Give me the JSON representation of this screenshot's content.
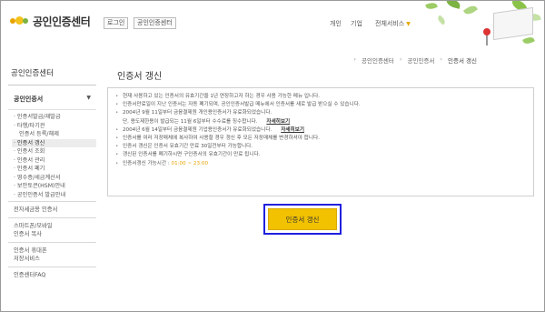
{
  "header": {
    "logo_text": "공인인증센터",
    "login_button": "로그인",
    "cert_center_button": "공인인증센터",
    "nav": {
      "personal": "개인",
      "corporate": "기업",
      "all_services": "전체서비스"
    }
  },
  "breadcrumb": [
    "공인인증센터",
    "공인인증서",
    "인증서 갱신"
  ],
  "sidebar": {
    "title": "공인인증센터",
    "section_header": "공인인증서",
    "sub_items": [
      "· 인증서발급/재발급",
      "· 타행/타기관",
      "  인증서 등록/해제",
      "· 인증서 갱신",
      "· 인증서 조회",
      "· 인증서 관리",
      "· 인증서 폐기",
      "· 영수증/세금계산서",
      "· 보안토큰(HSM)안내",
      "· 공인인증서 발급안내"
    ],
    "active_index": 3,
    "groups": [
      [
        "전자세금용 인증서"
      ],
      [
        "스마트폰/모바일",
        "인증서 복사"
      ],
      [
        "인증서 휴대폰",
        "저장서비스"
      ],
      [
        "인증센터FAQ"
      ]
    ]
  },
  "main": {
    "title": "인증서 갱신",
    "notices": [
      {
        "text": "현재 사용하고 있는 인증서의 유효기간을 1년 연장하고자 하는 경우 사용 가능한 메뉴 입니다."
      },
      {
        "text": "인증서만료일이 지난 인증서는 자동 폐기되며, 공인인증서발급 메뉴에서 인증서를 새로 발급 받으실 수 있습니다."
      },
      {
        "text": "2004년 9월 11일부터 금융결제원 개인용인증서가 유료화되었습니다.",
        "text2": "단, 용도제한용이 발급되는 11월 6일부터 수수료를 징수합니다.",
        "link": "자세히보기"
      },
      {
        "text": "2004년 6월 14일부터 금융결제원 기업용인증서가 유료화되었습니다.",
        "link": "자세히보기"
      },
      {
        "text": "인증서를 여러 저장매체에 복사하여 사용할 경우 갱신 후 모든 저장매체를 변경하셔야 합니다."
      },
      {
        "text": "인증서 갱신은 인증서 유효기간 만료 30일전부터 가능합니다."
      },
      {
        "text": "갱신된 인증서를 폐기하시면 구인증서의 유효기간이 만료 됩니다."
      },
      {
        "text": "인증서갱신 가능시간 : ",
        "time": "01:00 ~ 23:00"
      }
    ],
    "renew_button": "인증서 갱신"
  },
  "colors": {
    "accent": "#f2c200",
    "highlight_border": "#2020dd",
    "time_text": "#e8a400"
  }
}
